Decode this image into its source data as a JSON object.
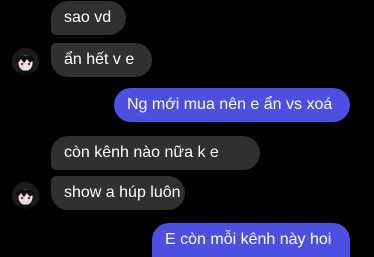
{
  "conversation": {
    "messages": [
      {
        "sender": "other",
        "text": "sao vd"
      },
      {
        "sender": "other",
        "text": "ẩn hết v e"
      },
      {
        "sender": "me",
        "text": "Ng mới mua nên e ẩn vs xoá"
      },
      {
        "sender": "other",
        "text": "còn kênh nào nữa k e"
      },
      {
        "sender": "other",
        "text": "show a húp luôn"
      },
      {
        "sender": "me",
        "text": "E còn mỗi kênh này hoi"
      }
    ]
  },
  "colors": {
    "background": "#000000",
    "incoming_bubble": "#303030",
    "outgoing_bubble": "#4d4fe0",
    "text": "#ffffff"
  },
  "icons": {
    "contact_avatar": "contact-avatar-icon"
  }
}
